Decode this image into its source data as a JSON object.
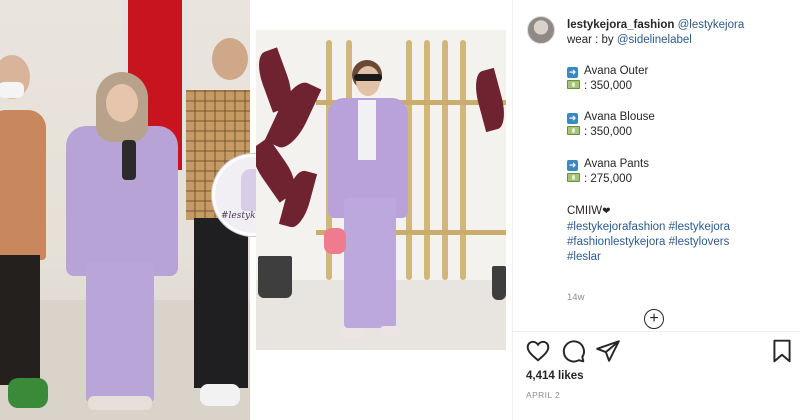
{
  "post": {
    "username": "lestykejora_fashion",
    "mention": "@lestykejora",
    "wear_prefix": "wear : by ",
    "wear_by": "@sidelinelabel",
    "items": [
      {
        "name": "Avana Outer",
        "price": ": 350,000"
      },
      {
        "name": "Avana Blouse",
        "price": ": 350,000"
      },
      {
        "name": "Avana Pants",
        "price": ": 275,000"
      }
    ],
    "note": "CMIIW",
    "hashtags_line1": "#lestykejorafashion #lestykejora",
    "hashtags_line2": "#fashionlestykejora #lestylovers",
    "hashtags_line3": "#leslar",
    "age": "14w",
    "likes": "4,414 likes",
    "date": "APRIL 2"
  },
  "media": {
    "inset_text": "#lestykejora_fashion"
  },
  "icons": {
    "arrow": "right-arrow-box-icon",
    "money": "banknote-icon",
    "like": "heart-icon",
    "comment": "comment-bubble-icon",
    "share": "paper-plane-icon",
    "save": "bookmark-icon",
    "add": "plus-circle-icon"
  },
  "colors": {
    "link": "#2d5a8c",
    "arrow_box": "#3b88c3",
    "muted": "#8e8e8e"
  }
}
